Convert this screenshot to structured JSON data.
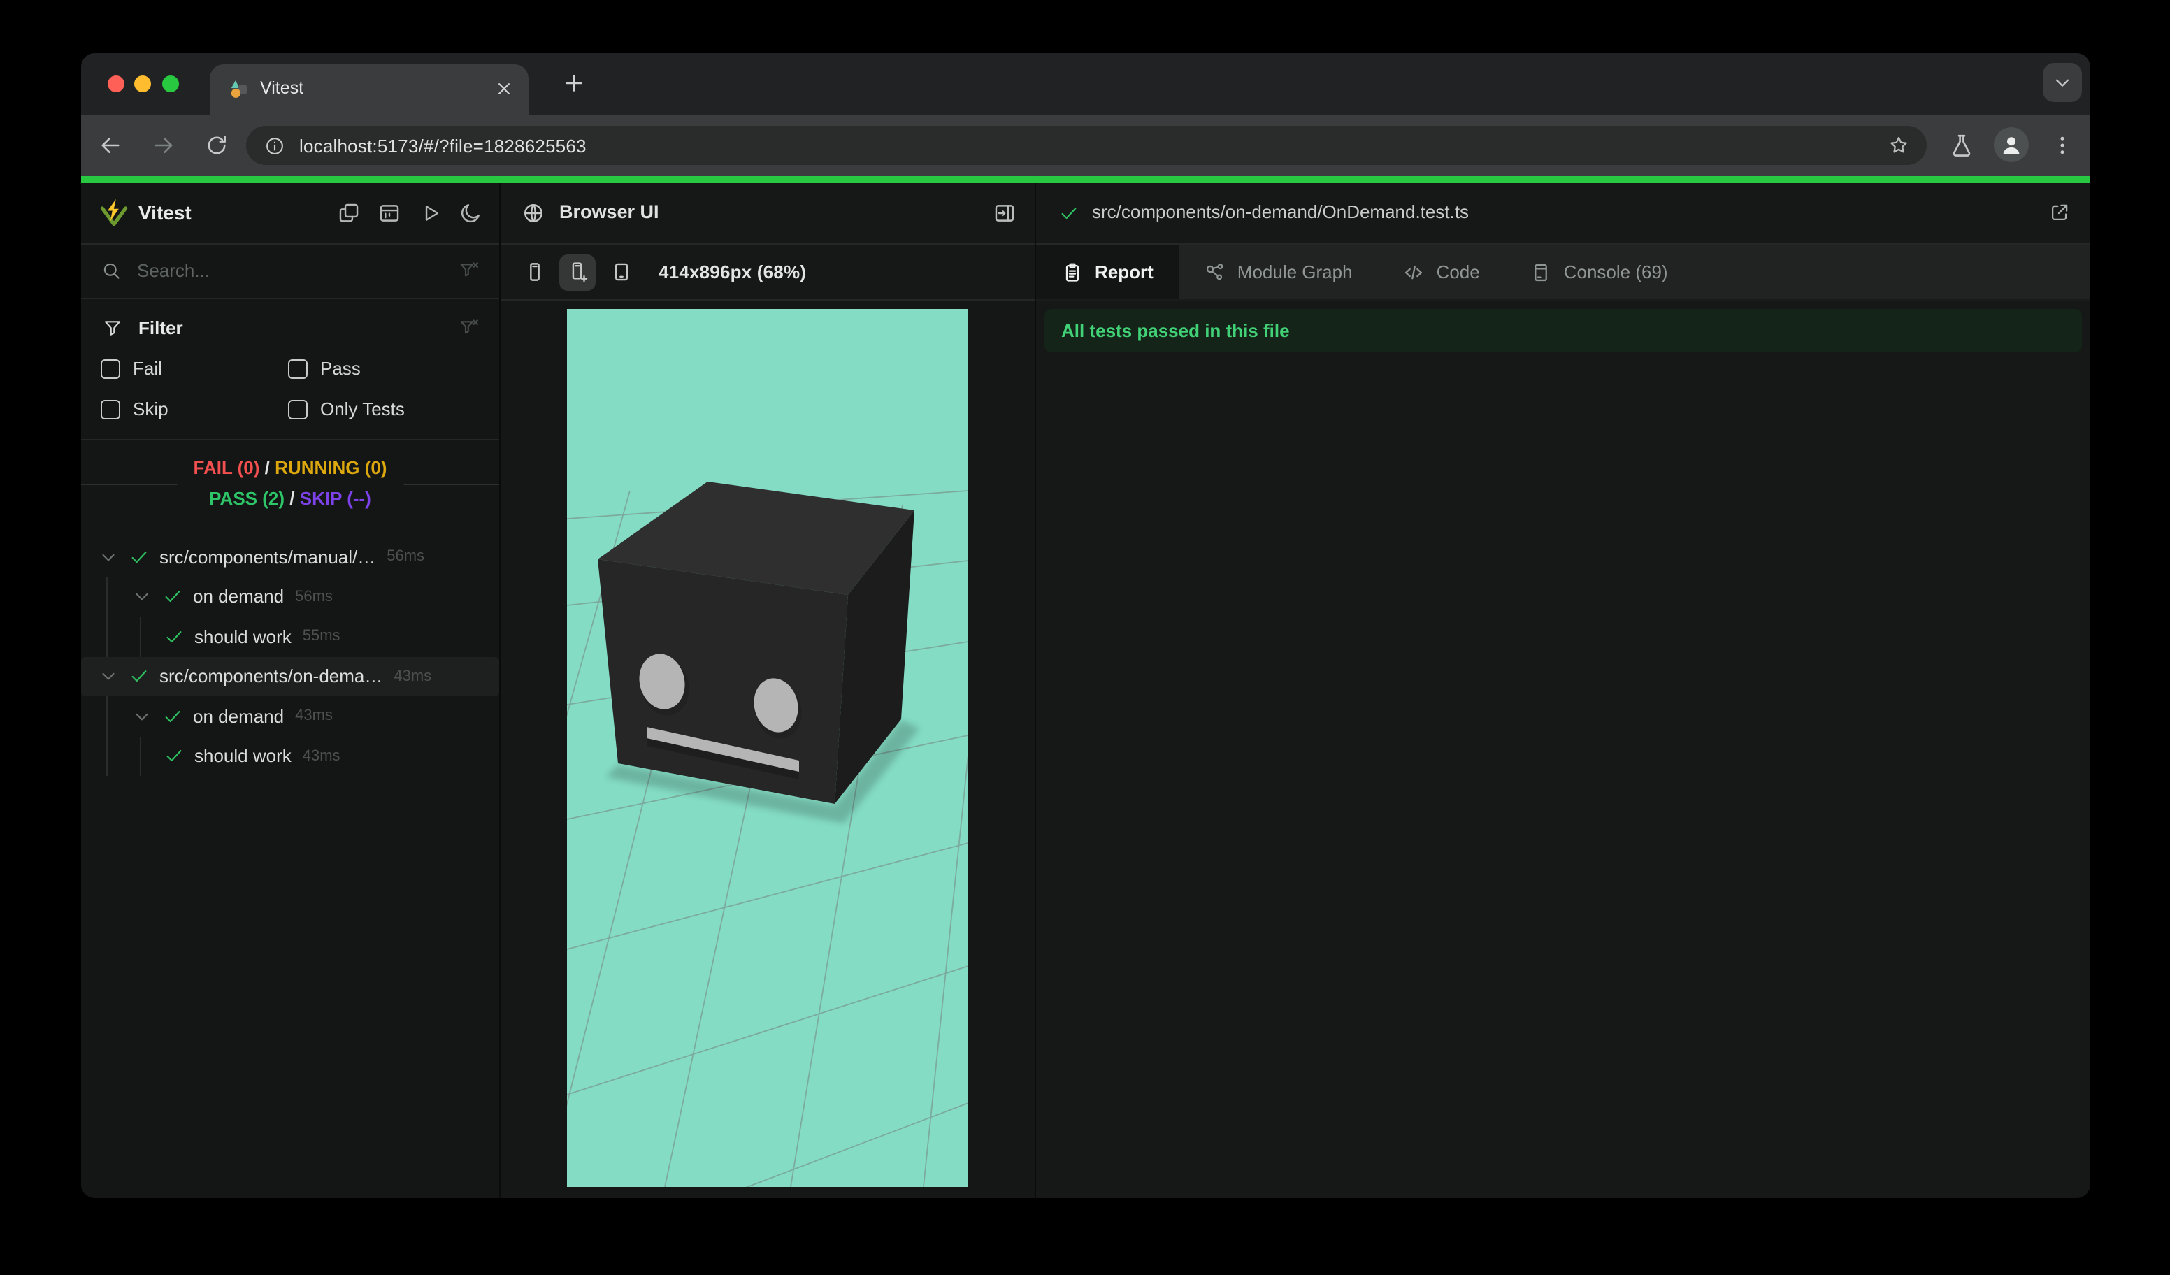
{
  "window": {
    "controls": [
      "close",
      "minimize",
      "zoom"
    ],
    "tab": {
      "title": "Vitest",
      "favicon": "vitest-favicon",
      "close_icon": "close-icon"
    },
    "new_tab_icon": "plus-icon",
    "tab_search_icon": "chevron-down-icon",
    "toolbar": {
      "back_icon": "arrow-left-icon",
      "forward_icon": "arrow-right-icon",
      "reload_icon": "reload-icon",
      "info_icon": "info-icon",
      "url": "localhost:5173/#/?file=1828625563",
      "bookmark_icon": "star-icon",
      "labs_icon": "flask-icon",
      "profile_icon": "person-icon",
      "menu_icon": "dots-vertical-icon"
    }
  },
  "app": {
    "progress_bar_color": "#28c840",
    "sidebar": {
      "title": "Vitest",
      "header_icons": [
        {
          "name": "collapse-details-icon"
        },
        {
          "name": "dashboard-icon"
        },
        {
          "name": "run-all-icon"
        },
        {
          "name": "theme-toggle-icon"
        }
      ],
      "search": {
        "icon": "search-icon",
        "placeholder": "Search...",
        "clear_icon": "filter-clear-icon"
      },
      "filter": {
        "icon": "filter-icon",
        "title": "Filter",
        "clear_icon": "filter-clear-icon",
        "options": [
          {
            "label": "Fail",
            "checked": false
          },
          {
            "label": "Pass",
            "checked": false
          },
          {
            "label": "Skip",
            "checked": false
          },
          {
            "label": "Only Tests",
            "checked": false
          }
        ]
      },
      "status": {
        "fail": "FAIL (0)",
        "running": "RUNNING (0)",
        "pass": "PASS (2)",
        "skip": "SKIP (--)",
        "separator": "/"
      },
      "status_colors": {
        "fail": "#f4504f",
        "running": "#dda80d",
        "pass": "#2ec569",
        "skip": "#7c42e8"
      },
      "tree": [
        {
          "depth": 0,
          "kind": "file",
          "label": "src/components/manual/…",
          "duration": "56ms",
          "expanded": true,
          "state": "pass",
          "selected": false
        },
        {
          "depth": 1,
          "kind": "suite",
          "label": "on demand",
          "duration": "56ms",
          "expanded": true,
          "state": "pass",
          "selected": false
        },
        {
          "depth": 2,
          "kind": "test",
          "label": "should work",
          "duration": "55ms",
          "state": "pass",
          "selected": false
        },
        {
          "depth": 0,
          "kind": "file",
          "label": "src/components/on-dema…",
          "duration": "43ms",
          "expanded": true,
          "state": "pass",
          "selected": true
        },
        {
          "depth": 1,
          "kind": "suite",
          "label": "on demand",
          "duration": "43ms",
          "expanded": true,
          "state": "pass",
          "selected": false
        },
        {
          "depth": 2,
          "kind": "test",
          "label": "should work",
          "duration": "43ms",
          "state": "pass",
          "selected": false
        }
      ]
    },
    "browser_panel": {
      "icon": "globe-icon",
      "title": "Browser UI",
      "expand_icon": "panel-right-icon",
      "toolbar": {
        "devices": [
          {
            "name": "device-phone-icon",
            "selected": false
          },
          {
            "name": "device-phone-add-icon",
            "selected": true
          },
          {
            "name": "device-tablet-icon",
            "selected": false
          }
        ],
        "size_label": "414x896px (68%)"
      },
      "scene": {
        "background": "#84dcc4",
        "grid_line_color": "#76847e",
        "cube_top": "#2f2f2f",
        "cube_front": "#262626",
        "cube_right": "#1c1c1c",
        "face_feature_color": "#b5b5b5"
      }
    },
    "report_panel": {
      "file_status_icon": "check-icon",
      "file_path": "src/components/on-demand/OnDemand.test.ts",
      "open_external_icon": "external-link-icon",
      "tabs": [
        {
          "label": "Report",
          "icon": "report-icon",
          "active": true
        },
        {
          "label": "Module Graph",
          "icon": "module-graph-icon",
          "active": false
        },
        {
          "label": "Code",
          "icon": "code-icon",
          "active": false
        },
        {
          "label": "Console (69)",
          "icon": "console-icon",
          "active": false
        }
      ],
      "banner": {
        "text": "All tests passed in this file",
        "text_color": "#41d277",
        "background": "#152419"
      }
    }
  }
}
